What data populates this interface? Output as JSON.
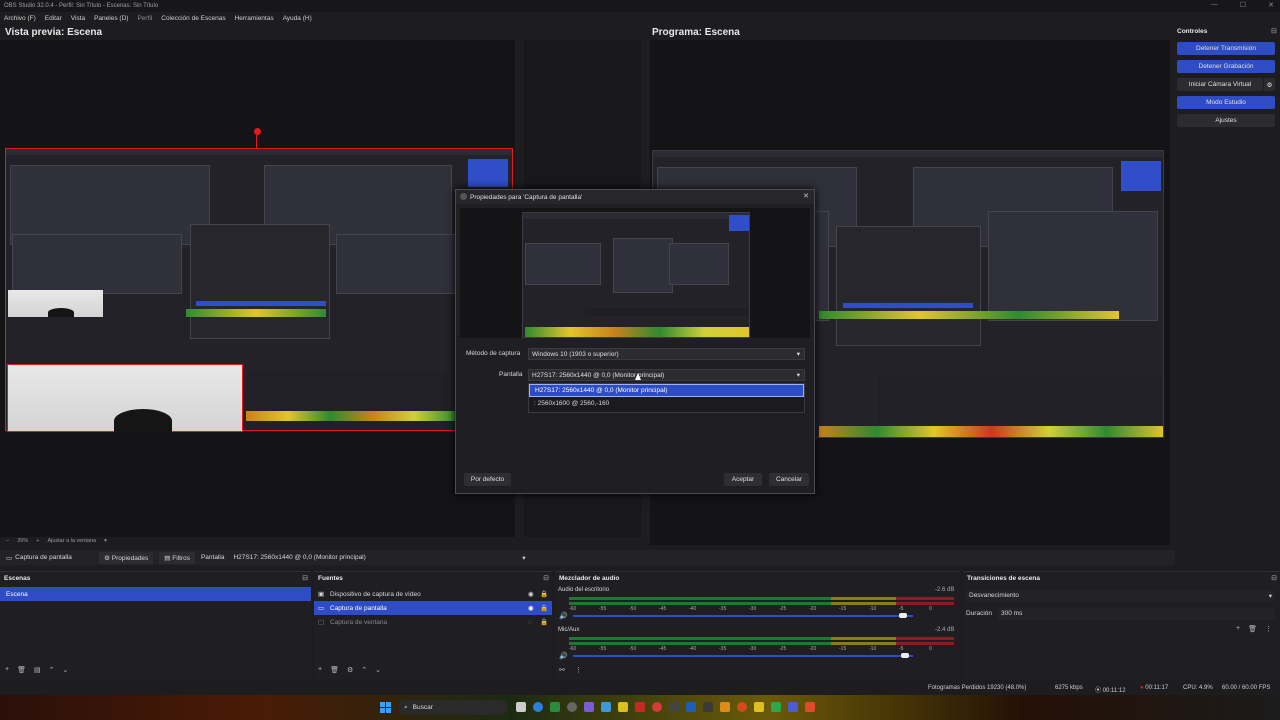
{
  "window": {
    "title": "OBS Studio 32.0.4 - Perfil: Sin Título - Escenas: Sin Título"
  },
  "menu": [
    "Archivo (F)",
    "Editar",
    "Vista",
    "Paneles (D)",
    "Perfil",
    "Colección de Escenas",
    "Herramientas",
    "Ayuda (H)"
  ],
  "preview": {
    "title": "Vista previa: Escena",
    "zoom": "39%",
    "fit": "Ajustar a la ventana"
  },
  "program": {
    "title": "Programa: Escena"
  },
  "controls": {
    "title": "Controles",
    "stop_stream": "Detener Transmisión",
    "stop_record": "Detener Grabación",
    "virtual_cam": "Iniciar Cámara Virtual",
    "studio_mode": "Modo Estudio",
    "settings": "Ajustes"
  },
  "source_toolbar": {
    "source": "Captura de pantalla",
    "properties": "Propiedades",
    "filters": "Filtros",
    "display_label": "Pantalla",
    "display_value": "H27S17: 2560x1440 @ 0,0 (Monitor principal)"
  },
  "scenes": {
    "title": "Escenas",
    "items": [
      "Escena"
    ]
  },
  "sources": {
    "title": "Fuentes",
    "items": [
      "Dispositivo de captura de vídeo",
      "Captura de pantalla",
      "Captura de ventana"
    ]
  },
  "mixer": {
    "title": "Mezclador de audio",
    "channels": [
      {
        "name": "Audio del escritorio",
        "db": "-2.6 dB"
      },
      {
        "name": "Mic/Aux",
        "db": "-2.4 dB"
      }
    ],
    "ticks": [
      "-60",
      "-55",
      "-50",
      "-45",
      "-40",
      "-35",
      "-30",
      "-25",
      "-20",
      "-15",
      "-10",
      "-5",
      "0"
    ]
  },
  "transitions": {
    "title": "Transiciones de escena",
    "type": "Desvanecimiento",
    "duration_label": "Duración",
    "duration_value": "300 ms"
  },
  "dialog": {
    "title": "Propiedades para 'Captura de pantalla'",
    "method_label": "Método de captura",
    "method_value": "Windows 10 (1903 o superior)",
    "display_label": "Pantalla",
    "display_value": "H27S17: 2560x1440 @ 0,0 (Monitor principal)",
    "options": [
      "H27S17: 2560x1440 @ 0,0 (Monitor principal)",
      ": 2560x1600 @ 2560,-160"
    ],
    "defaults": "Por defecto",
    "ok": "Aceptar",
    "cancel": "Cancelar"
  },
  "status": {
    "dropped": "Fotogramas Perdidos 19230 (48.0%)",
    "bitrate": "6275 kbps",
    "stream_time": "00:11:12",
    "rec_time": "00:11:17",
    "cpu": "CPU: 4.9%",
    "fps": "60.00 / 60.00 FPS"
  },
  "taskbar": {
    "search": "Buscar"
  }
}
